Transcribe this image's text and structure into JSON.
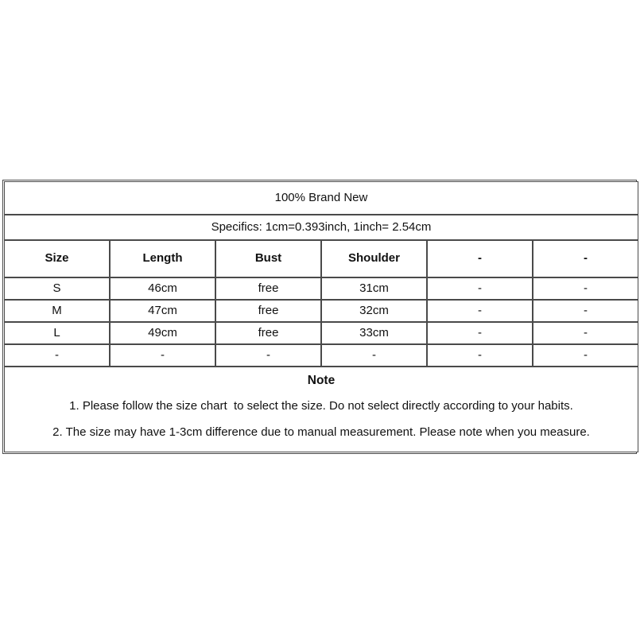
{
  "chart": {
    "title_row": "100% Brand New",
    "specifics_row": "Specifics: 1cm=0.393inch, 1inch= 2.54cm",
    "headers": [
      "Size",
      "Length",
      "Bust",
      "Shoulder",
      "-",
      "-"
    ],
    "rows": [
      [
        "S",
        "46cm",
        "free",
        "31cm",
        "-",
        "-"
      ],
      [
        "M",
        "47cm",
        "free",
        "32cm",
        "-",
        "-"
      ],
      [
        "L",
        "49cm",
        "free",
        "33cm",
        "-",
        "-"
      ],
      [
        "-",
        "-",
        "-",
        "-",
        "-",
        "-"
      ]
    ],
    "note": {
      "heading": "Note",
      "lines": [
        "1. Please follow the size chart  to select the size. Do not select directly according to your habits.",
        "2. The size may have 1-3cm difference due to manual measurement. Please note when you measure."
      ]
    },
    "colors": {
      "background": "#ffffff",
      "border": "#4a4a4a",
      "text": "#111111"
    }
  }
}
